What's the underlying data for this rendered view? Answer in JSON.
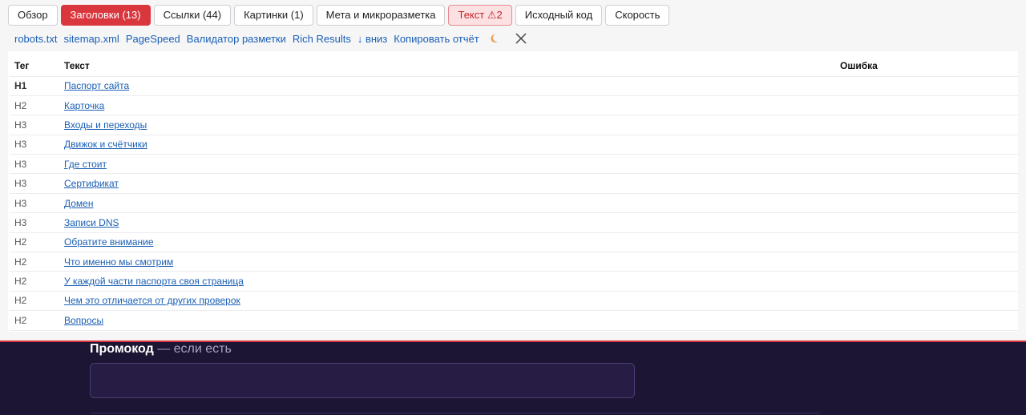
{
  "tabs": [
    {
      "label": "Обзор",
      "state": "normal"
    },
    {
      "label": "Заголовки (13)",
      "state": "active"
    },
    {
      "label": "Ссылки (44)",
      "state": "normal"
    },
    {
      "label": "Картинки (1)",
      "state": "normal"
    },
    {
      "label": "Мета и микроразметка",
      "state": "normal"
    },
    {
      "label": "Текст ⚠2",
      "state": "warn"
    },
    {
      "label": "Исходный код",
      "state": "normal"
    },
    {
      "label": "Скорость",
      "state": "normal"
    }
  ],
  "toolbar_links": {
    "robots": "robots.txt",
    "sitemap": "sitemap.xml",
    "pagespeed": "PageSpeed",
    "validator": "Валидатор разметки",
    "rich": "Rich Results",
    "down": "↓ вниз",
    "copy": "Копировать отчёт",
    "theme_icon": "moon-icon",
    "close_icon": "close-icon"
  },
  "headings_table": {
    "columns": {
      "tag": "Тег",
      "text": "Текст",
      "error": "Ошибка"
    },
    "rows": [
      {
        "tag": "H1",
        "text": "Паспорт сайта",
        "error": ""
      },
      {
        "tag": "H2",
        "text": "Карточка",
        "error": ""
      },
      {
        "tag": "H3",
        "text": "Входы и переходы",
        "error": ""
      },
      {
        "tag": "H3",
        "text": "Движок и счётчики",
        "error": ""
      },
      {
        "tag": "H3",
        "text": "Где стоит",
        "error": ""
      },
      {
        "tag": "H3",
        "text": "Сертификат",
        "error": ""
      },
      {
        "tag": "H3",
        "text": "Домен",
        "error": ""
      },
      {
        "tag": "H3",
        "text": "Записи DNS",
        "error": ""
      },
      {
        "tag": "H2",
        "text": "Обратите внимание",
        "error": ""
      },
      {
        "tag": "H2",
        "text": "Что именно мы смотрим",
        "error": ""
      },
      {
        "tag": "H2",
        "text": "У каждой части паспорта своя страница",
        "error": ""
      },
      {
        "tag": "H2",
        "text": "Чем это отличается от других проверок",
        "error": ""
      },
      {
        "tag": "H2",
        "text": "Вопросы",
        "error": ""
      }
    ]
  },
  "promo": {
    "label_bold": "Промокод",
    "label_rest": " — если есть",
    "input_value": ""
  },
  "colors": {
    "accent": "#d9363e",
    "link": "#1a5fb4",
    "page_bg": "#1d1534"
  }
}
